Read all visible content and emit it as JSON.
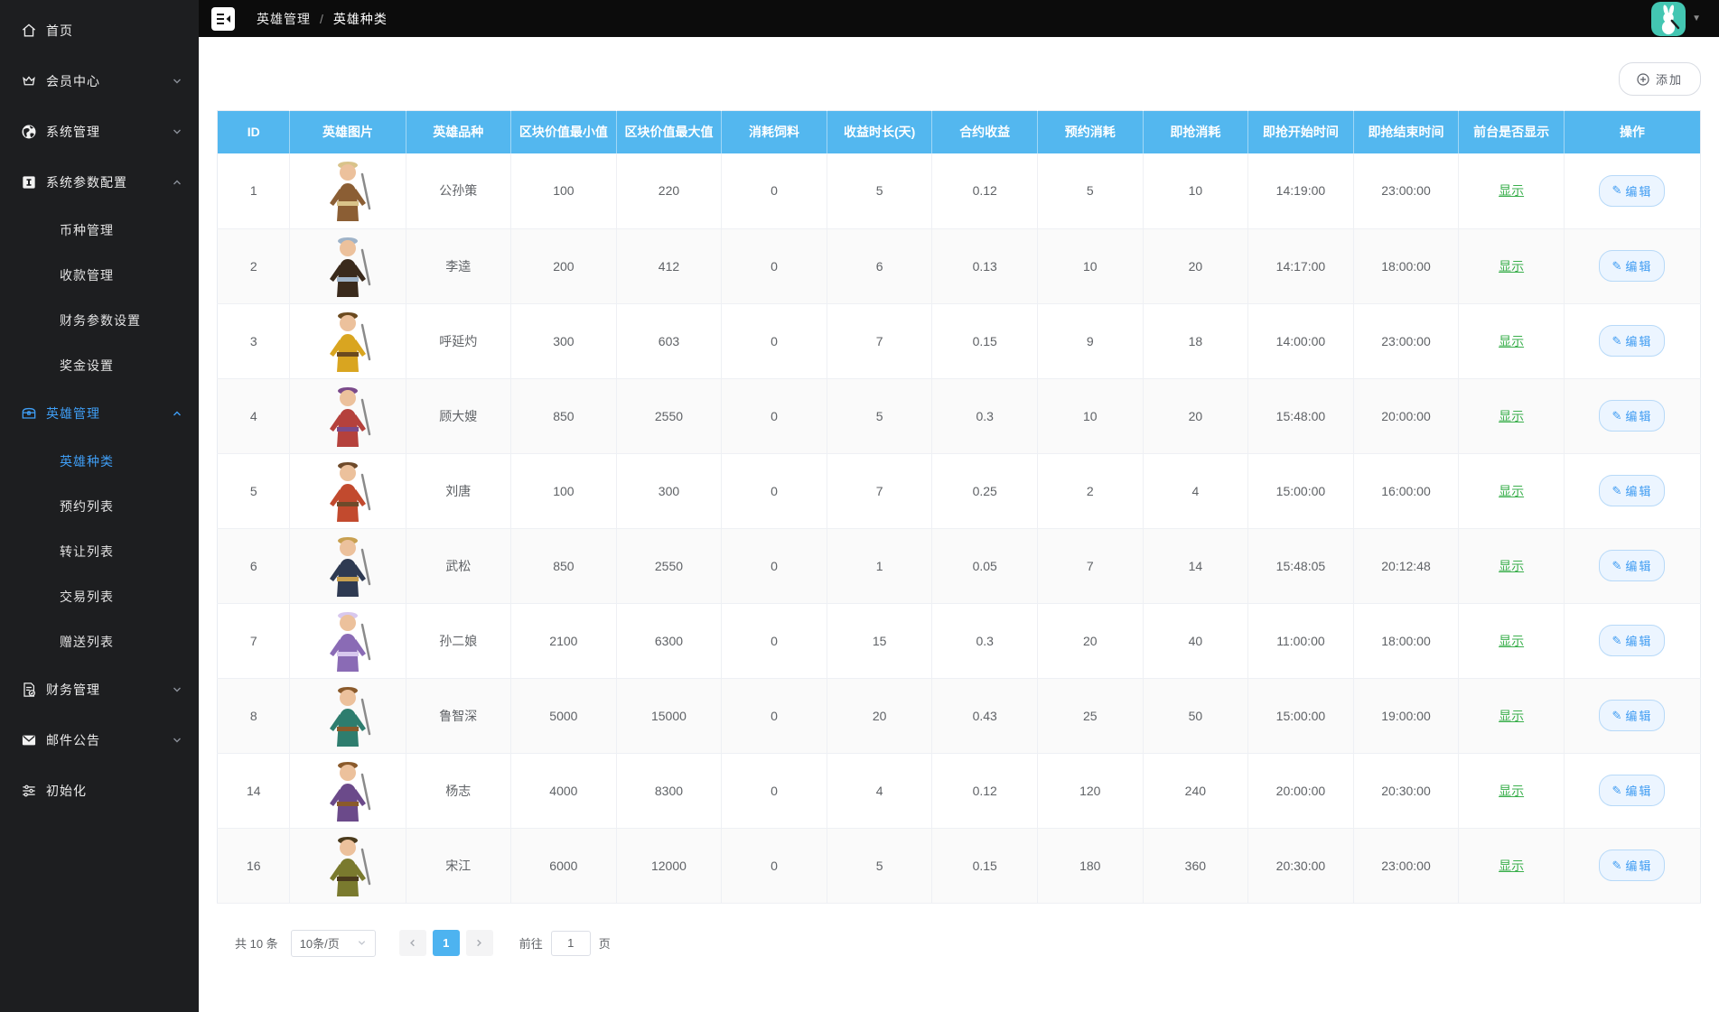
{
  "colors": {
    "table_header_blue": "#53b7ef",
    "active_menu_blue": "#3f9ef5",
    "show_link_green": "#3aaf4c",
    "edit_button_blue": "#3f9cf2",
    "avatar_teal": "#43c6b2",
    "active_page_blue": "#4db3f0"
  },
  "sidebar": {
    "items": [
      {
        "label": "首页",
        "icon": "home-icon"
      },
      {
        "label": "会员中心",
        "icon": "crown-icon",
        "chevron": "down"
      },
      {
        "label": "系统管理",
        "icon": "globe-icon",
        "chevron": "down"
      },
      {
        "label": "系统参数配置",
        "icon": "config-icon",
        "chevron": "up",
        "children": [
          {
            "label": "币种管理"
          },
          {
            "label": "收款管理"
          },
          {
            "label": "财务参数设置"
          },
          {
            "label": "奖金设置"
          }
        ]
      },
      {
        "label": "英雄管理",
        "icon": "chest-icon",
        "chevron": "up",
        "active": true,
        "children": [
          {
            "label": "英雄种类",
            "active": true
          },
          {
            "label": "预约列表"
          },
          {
            "label": "转让列表"
          },
          {
            "label": "交易列表"
          },
          {
            "label": "赠送列表"
          }
        ]
      },
      {
        "label": "财务管理",
        "icon": "finance-icon",
        "chevron": "down"
      },
      {
        "label": "邮件公告",
        "icon": "mail-icon",
        "chevron": "down"
      },
      {
        "label": "初始化",
        "icon": "sliders-icon"
      }
    ]
  },
  "header": {
    "breadcrumb": [
      "英雄管理",
      "英雄种类"
    ],
    "separator": "/"
  },
  "toolbar": {
    "add_label": "添加"
  },
  "table": {
    "columns": [
      "ID",
      "英雄图片",
      "英雄品种",
      "区块价值最小值",
      "区块价值最大值",
      "消耗饲料",
      "收益时长(天)",
      "合约收益",
      "预约消耗",
      "即抢消耗",
      "即抢开始时间",
      "即抢结束时间",
      "前台是否显示",
      "操作"
    ],
    "rows": [
      {
        "id": "1",
        "name": "公孙策",
        "min": "100",
        "max": "220",
        "feed": "0",
        "days": "5",
        "profit": "0.12",
        "reserve": "5",
        "grab": "10",
        "start": "14:19:00",
        "end": "23:00:00",
        "visible": "显示",
        "edit": "编辑",
        "colors": [
          "#8b5e34",
          "#d9c38a"
        ]
      },
      {
        "id": "2",
        "name": "李逵",
        "min": "200",
        "max": "412",
        "feed": "0",
        "days": "6",
        "profit": "0.13",
        "reserve": "10",
        "grab": "20",
        "start": "14:17:00",
        "end": "18:00:00",
        "visible": "显示",
        "edit": "编辑",
        "colors": [
          "#3a2a1c",
          "#9fb3c8"
        ]
      },
      {
        "id": "3",
        "name": "呼延灼",
        "min": "300",
        "max": "603",
        "feed": "0",
        "days": "7",
        "profit": "0.15",
        "reserve": "9",
        "grab": "18",
        "start": "14:00:00",
        "end": "23:00:00",
        "visible": "显示",
        "edit": "编辑",
        "colors": [
          "#d9a520",
          "#6b4a1f"
        ]
      },
      {
        "id": "4",
        "name": "顾大嫂",
        "min": "850",
        "max": "2550",
        "feed": "0",
        "days": "5",
        "profit": "0.3",
        "reserve": "10",
        "grab": "20",
        "start": "15:48:00",
        "end": "20:00:00",
        "visible": "显示",
        "edit": "编辑",
        "colors": [
          "#b5413c",
          "#7a4a8a"
        ]
      },
      {
        "id": "5",
        "name": "刘唐",
        "min": "100",
        "max": "300",
        "feed": "0",
        "days": "7",
        "profit": "0.25",
        "reserve": "2",
        "grab": "4",
        "start": "15:00:00",
        "end": "16:00:00",
        "visible": "显示",
        "edit": "编辑",
        "colors": [
          "#c24a2e",
          "#6e4a2a"
        ]
      },
      {
        "id": "6",
        "name": "武松",
        "min": "850",
        "max": "2550",
        "feed": "0",
        "days": "1",
        "profit": "0.05",
        "reserve": "7",
        "grab": "14",
        "start": "15:48:05",
        "end": "20:12:48",
        "visible": "显示",
        "edit": "编辑",
        "colors": [
          "#2e3a52",
          "#c8a050"
        ]
      },
      {
        "id": "7",
        "name": "孙二娘",
        "min": "2100",
        "max": "6300",
        "feed": "0",
        "days": "15",
        "profit": "0.3",
        "reserve": "20",
        "grab": "40",
        "start": "11:00:00",
        "end": "18:00:00",
        "visible": "显示",
        "edit": "编辑",
        "colors": [
          "#8a6bb5",
          "#d8c8ee"
        ]
      },
      {
        "id": "8",
        "name": "鲁智深",
        "min": "5000",
        "max": "15000",
        "feed": "0",
        "days": "20",
        "profit": "0.43",
        "reserve": "25",
        "grab": "50",
        "start": "15:00:00",
        "end": "19:00:00",
        "visible": "显示",
        "edit": "编辑",
        "colors": [
          "#2e7d6e",
          "#8a5a2b"
        ]
      },
      {
        "id": "14",
        "name": "杨志",
        "min": "4000",
        "max": "8300",
        "feed": "0",
        "days": "4",
        "profit": "0.12",
        "reserve": "120",
        "grab": "240",
        "start": "20:00:00",
        "end": "20:30:00",
        "visible": "显示",
        "edit": "编辑",
        "colors": [
          "#6b4a8a",
          "#8a5a2b"
        ]
      },
      {
        "id": "16",
        "name": "宋江",
        "min": "6000",
        "max": "12000",
        "feed": "0",
        "days": "5",
        "profit": "0.15",
        "reserve": "180",
        "grab": "360",
        "start": "20:30:00",
        "end": "23:00:00",
        "visible": "显示",
        "edit": "编辑",
        "colors": [
          "#7a7a2e",
          "#4a3a1c"
        ]
      }
    ]
  },
  "pagination": {
    "total": "共 10 条",
    "page_size": "10条/页",
    "current_page": "1",
    "goto_label": "前往",
    "goto_value": "1",
    "goto_suffix": "页"
  }
}
